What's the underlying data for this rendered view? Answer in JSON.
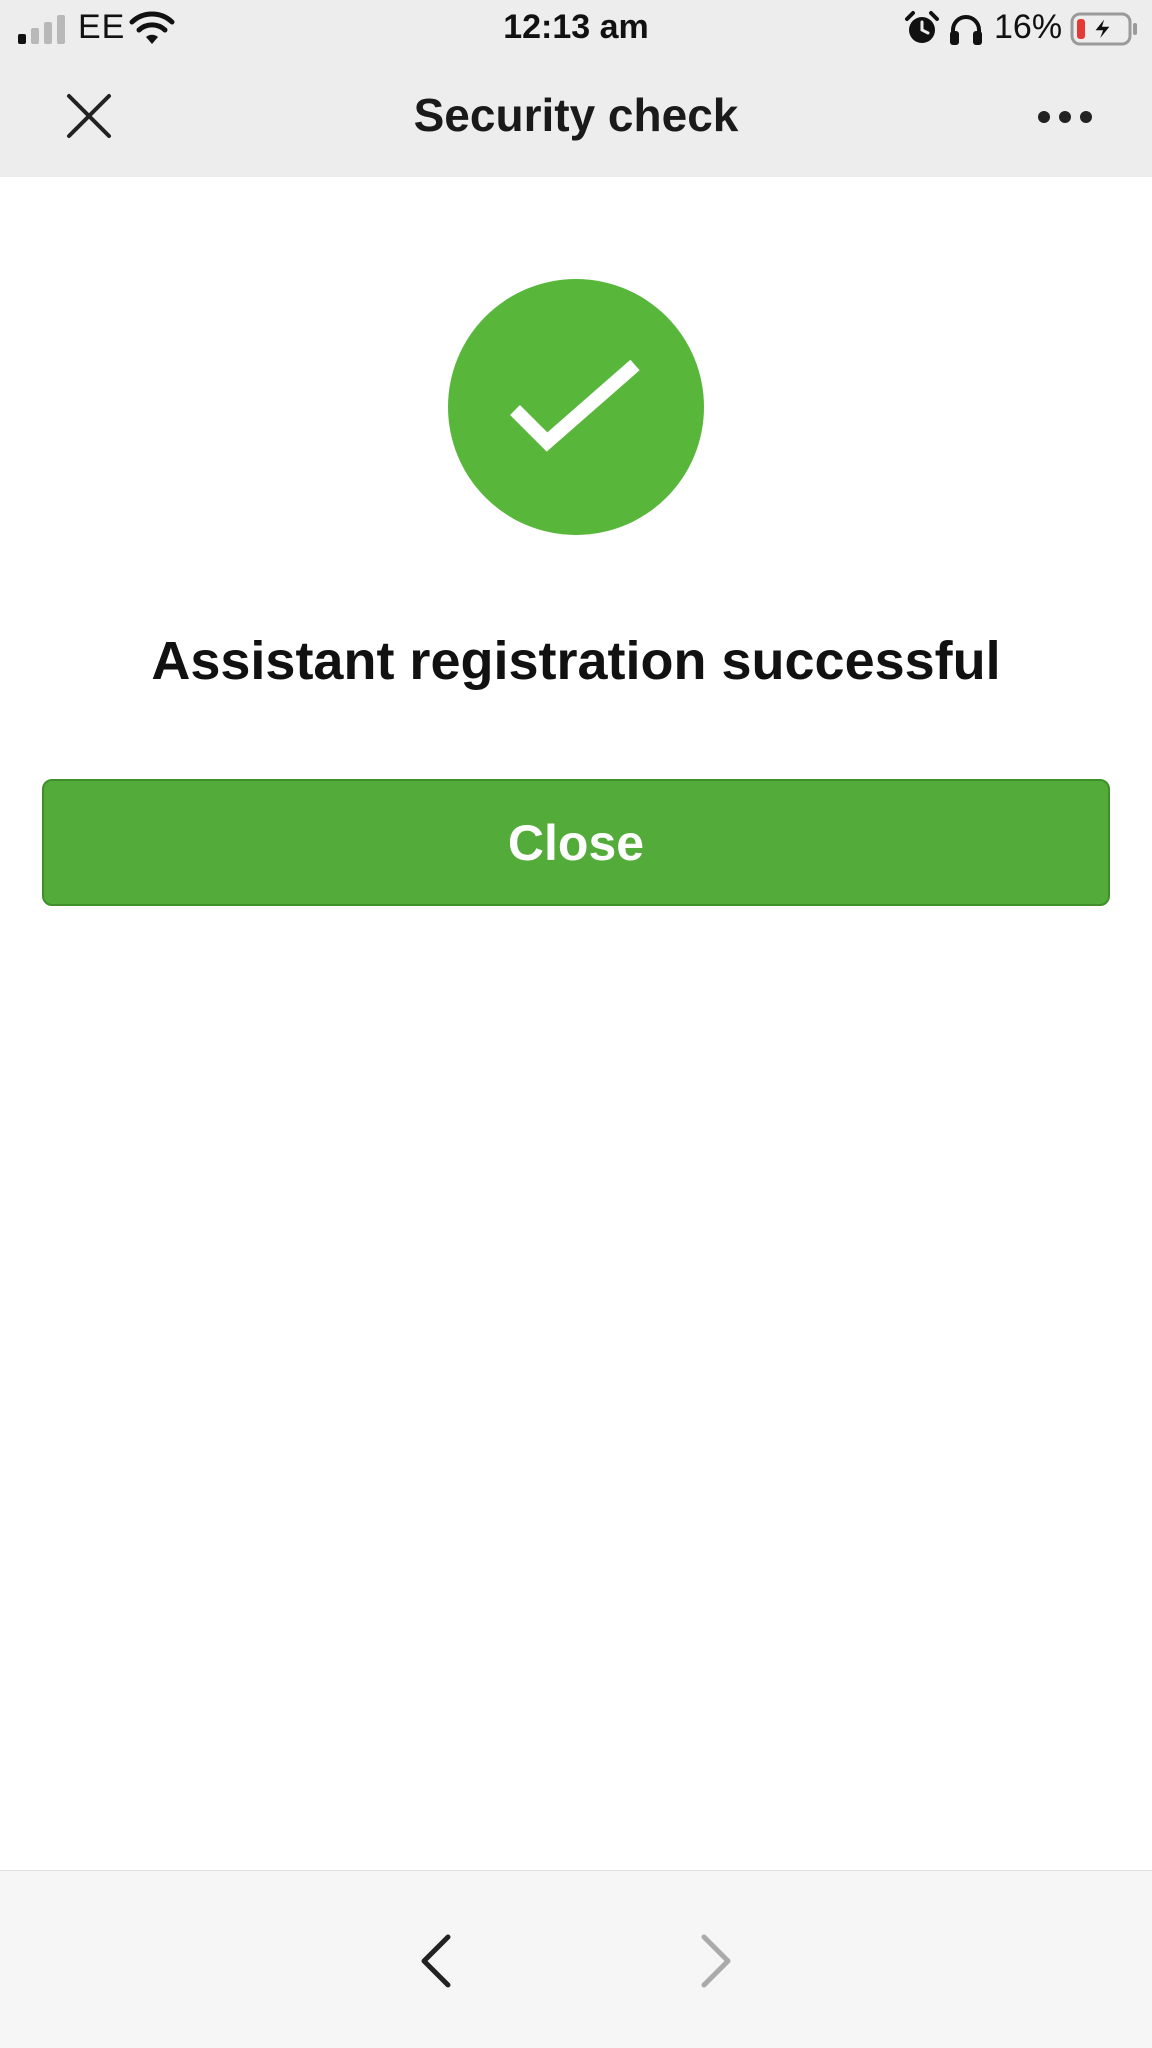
{
  "status_bar": {
    "carrier": "EE",
    "time": "12:13 am",
    "battery_percent": "16%",
    "icons": [
      "signal-icon",
      "wifi-icon",
      "alarm-icon",
      "headphones-icon",
      "battery-charging-icon"
    ]
  },
  "nav": {
    "title": "Security check",
    "left_icon": "close-icon",
    "right_icon": "more-icon"
  },
  "main": {
    "status_icon": "checkmark-icon",
    "message": "Assistant registration successful",
    "close_button_label": "Close"
  },
  "bottom_bar": {
    "back_icon": "chevron-left-icon",
    "forward_icon": "chevron-right-icon"
  },
  "colors": {
    "accent_green": "#58b73a",
    "button_green": "#53ab39",
    "header_bg": "#ededed",
    "battery_low": "#e53935"
  }
}
